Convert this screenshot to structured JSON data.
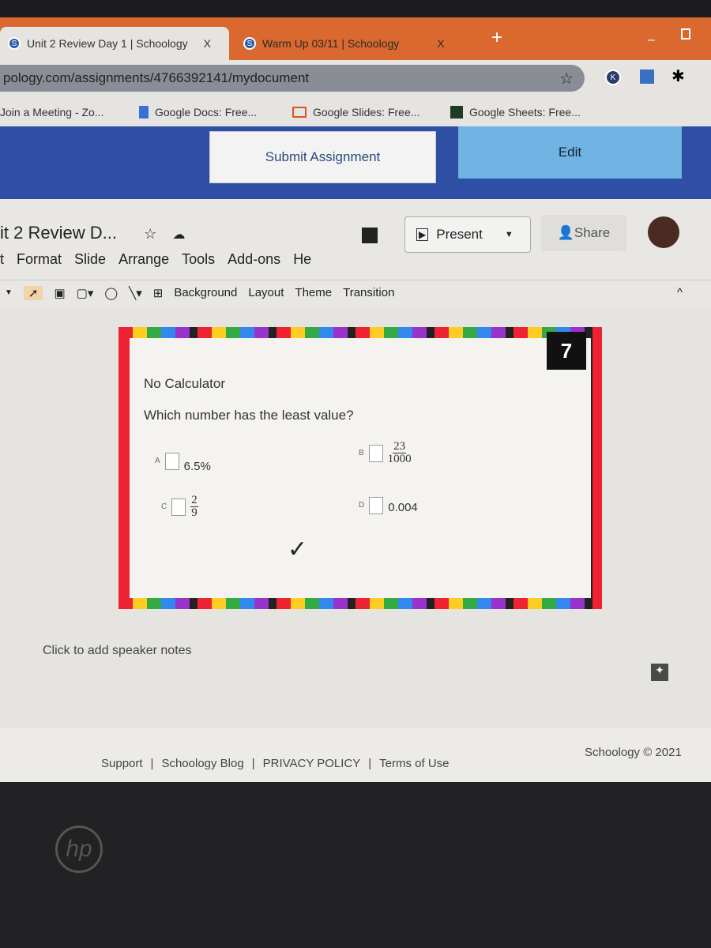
{
  "browser": {
    "tabs": [
      {
        "label": "Unit 2 Review Day 1 | Schoology",
        "close": "X"
      },
      {
        "label": "Warm Up 03/11 | Schoology",
        "close": "X"
      }
    ],
    "new_tab": "+",
    "url": "pology.com/assignments/4766392141/mydocument",
    "extensions": [
      "K"
    ],
    "bookmarks": [
      "Join a Meeting - Zo...",
      "Google Docs: Free...",
      "Google Slides: Free...",
      "Google Sheets: Free..."
    ],
    "accent": "#d9692e"
  },
  "schoology": {
    "submit": "Submit Assignment",
    "edit": "Edit",
    "band_color": "#2f4fa5"
  },
  "slides": {
    "title": "it 2 Review D...",
    "menu": [
      "t",
      "Format",
      "Slide",
      "Arrange",
      "Tools",
      "Add-ons",
      "He"
    ],
    "present": "Present",
    "share": "Share",
    "toolbar": [
      "Background",
      "Layout",
      "Theme",
      "Transition"
    ],
    "notes": "Click to add speaker notes"
  },
  "slide": {
    "number": "7",
    "heading": "No Calculator",
    "question": "Which number has the least value?",
    "options": [
      {
        "letter": "A",
        "value": "6.5%"
      },
      {
        "letter": "B",
        "num": "23",
        "den": "1000"
      },
      {
        "letter": "C",
        "num": "2",
        "den": "9"
      },
      {
        "letter": "D",
        "value": "0.004"
      }
    ],
    "check": "✓"
  },
  "footer": {
    "links": [
      "Support",
      "Schoology Blog",
      "PRIVACY POLICY",
      "Terms of Use"
    ],
    "sep": "|",
    "copyright": "Schoology © 2021"
  },
  "device": {
    "logo": "hp"
  }
}
